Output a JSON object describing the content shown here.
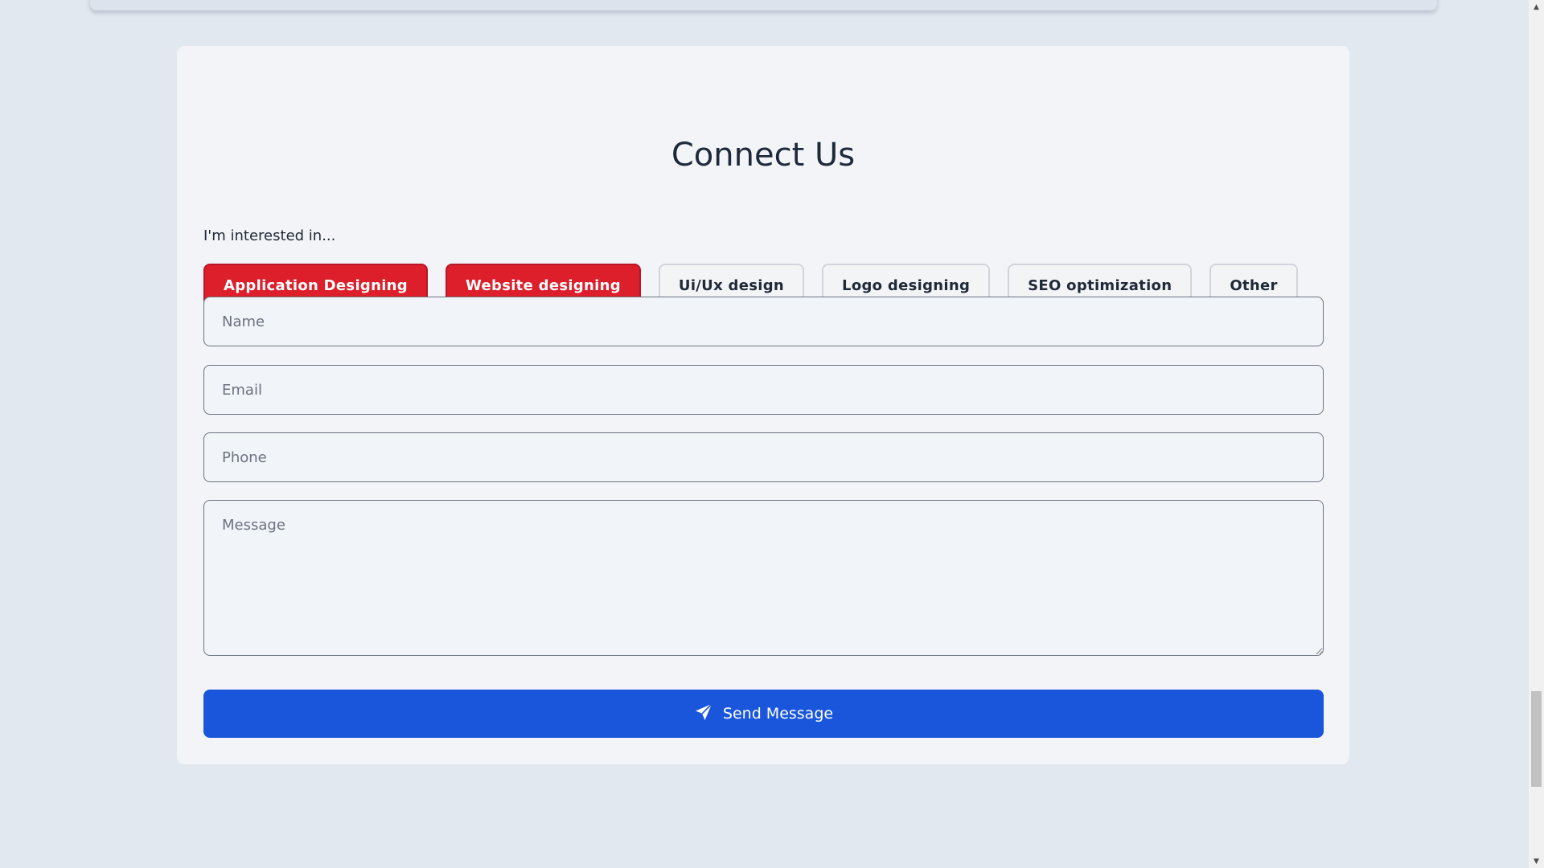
{
  "contact": {
    "title": "Connect Us",
    "interest_label": "I'm interested in...",
    "chips": [
      {
        "label": "Application Designing",
        "selected": true
      },
      {
        "label": "Website designing",
        "selected": true
      },
      {
        "label": "Ui/Ux design",
        "selected": false
      },
      {
        "label": "Logo designing",
        "selected": false
      },
      {
        "label": "SEO optimization",
        "selected": false
      },
      {
        "label": "Other",
        "selected": false
      }
    ],
    "fields": {
      "name_placeholder": "Name",
      "email_placeholder": "Email",
      "phone_placeholder": "Phone",
      "message_placeholder": "Message"
    },
    "send_label": "Send Message"
  },
  "icons": {
    "send": "paper-plane-icon",
    "scroll_up": "scroll-up-arrow-icon",
    "scroll_down": "scroll-down-arrow-icon"
  },
  "colors": {
    "chip_selected_bg": "#dc1f2b",
    "chip_selected_border": "#b8162a",
    "send_button_bg": "#1a56db",
    "page_bg": "#e2e8f0",
    "card_bg": "#f2f4f7"
  }
}
